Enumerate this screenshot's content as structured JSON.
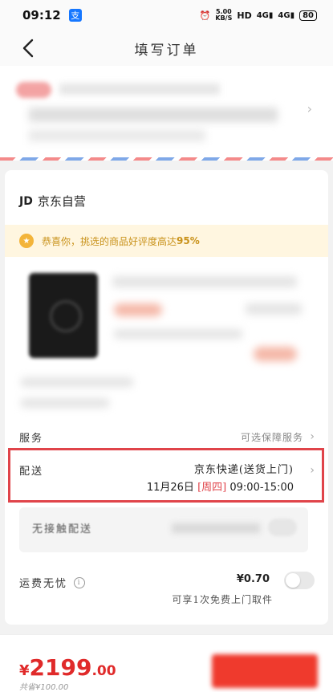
{
  "status_bar": {
    "time": "09:12",
    "app_badge": "支",
    "speed": "5.00",
    "speed_unit": "KB/S",
    "hd": "HD",
    "net1": "4G",
    "net2": "4G",
    "battery": "80"
  },
  "nav": {
    "title": "填写订单"
  },
  "shop": {
    "logo": "JD",
    "name": "京东自营"
  },
  "tip": {
    "text": "恭喜你，挑选的商品好评度高达",
    "highlight": "95%"
  },
  "services": {
    "label": "服务",
    "value": "可选保障服务"
  },
  "delivery": {
    "label": "配送",
    "method": "京东快递(送货上门)",
    "date": "11月26日",
    "weekday": "[周四]",
    "window": "09:00-15:00"
  },
  "no_contact": {
    "label": "无接触配送"
  },
  "insurance": {
    "label": "运费无忧",
    "price": "¥0.70",
    "note": "可享1次免费上门取件"
  },
  "bottom": {
    "currency": "¥",
    "price_int": "2199",
    "price_dec": ".00",
    "saved": "共省¥100.00"
  },
  "colors": {
    "accent": "#e02a2a",
    "highlight_box": "#e0444a",
    "tip_bg": "#fff6e0"
  }
}
